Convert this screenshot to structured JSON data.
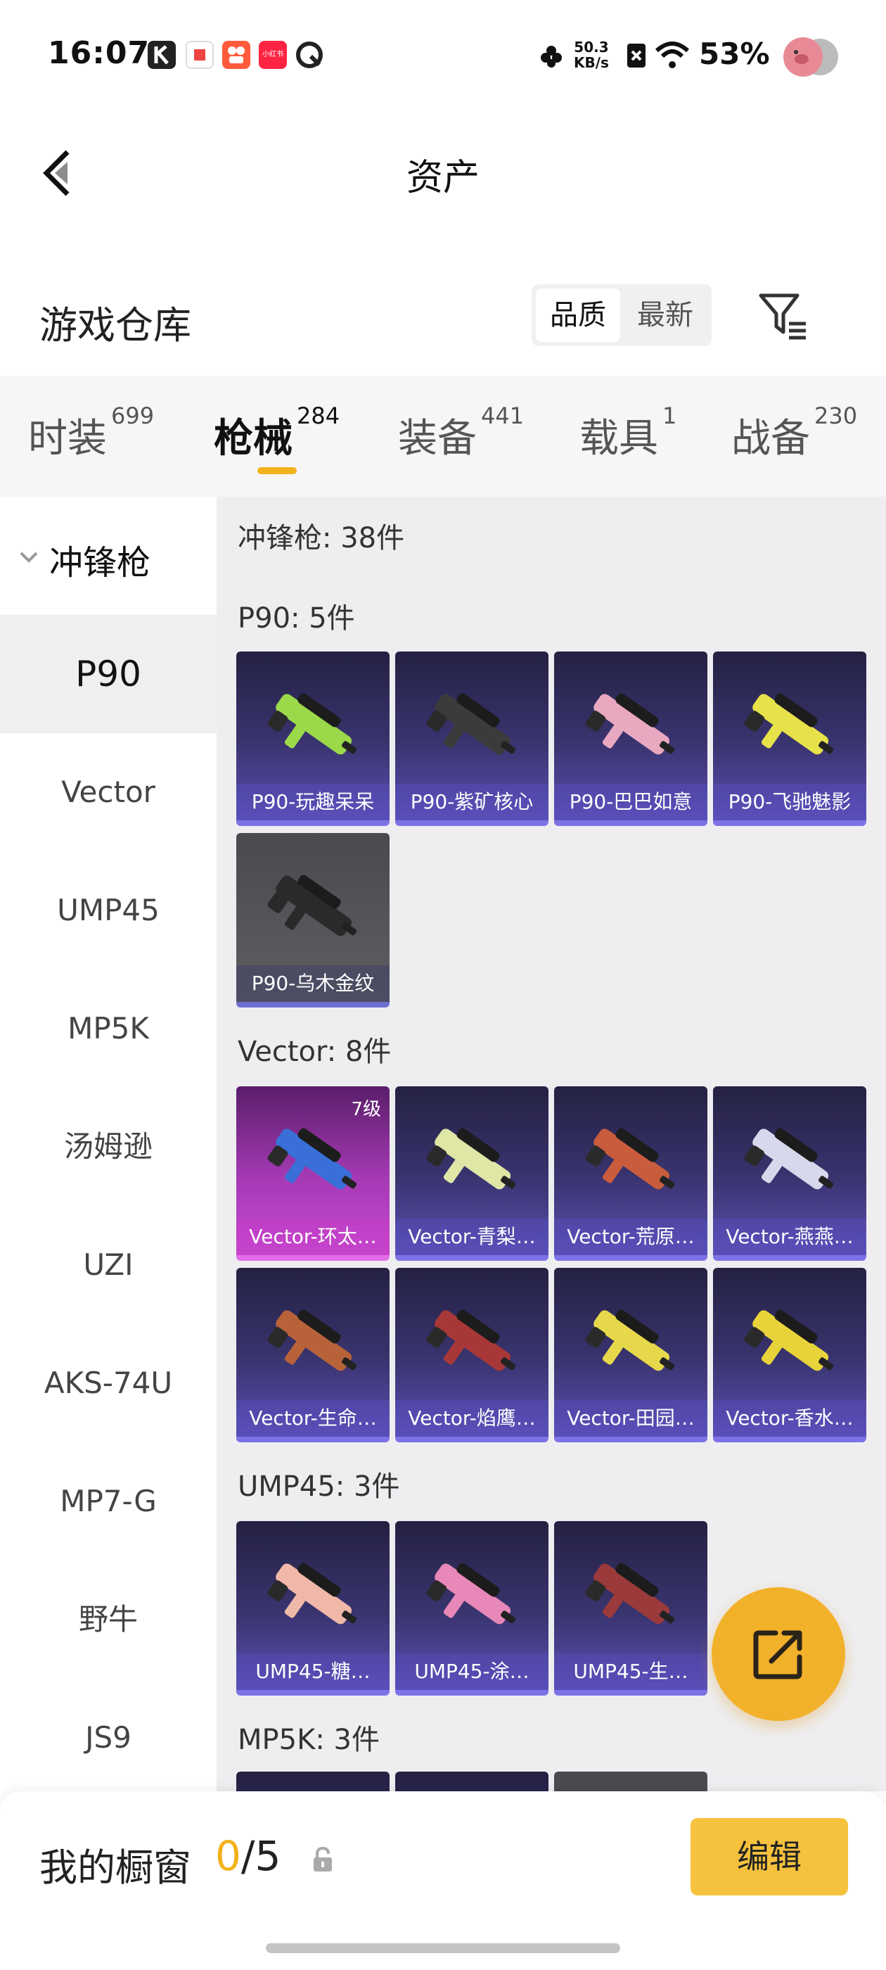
{
  "status_bar": {
    "time": "16:07",
    "net_speed_value": "50.3",
    "net_speed_unit": "KB/s",
    "battery": "53%",
    "icons": [
      "k-app-icon",
      "notification-icon",
      "kuaishou-icon",
      "xiaohongshu-icon",
      "browser-icon",
      "flower-icon",
      "sim-off-icon",
      "wifi-icon",
      "pig-avatar-icon"
    ],
    "mini_icon_text": "小红书"
  },
  "header": {
    "title": "资产",
    "back_icon": "back-chevron-icon"
  },
  "warehouse": {
    "title": "游戏仓库",
    "sort_options": [
      "品质",
      "最新"
    ],
    "sort_selected": "品质",
    "filter_icon": "filter-icon"
  },
  "category_tabs": [
    {
      "label": "时装",
      "count": "699"
    },
    {
      "label": "枪械",
      "count": "284",
      "active": true
    },
    {
      "label": "装备",
      "count": "441"
    },
    {
      "label": "载具",
      "count": "1"
    },
    {
      "label": "战备",
      "count": "230"
    }
  ],
  "sidebar": {
    "group_label": "冲锋枪",
    "items": [
      "P90",
      "Vector",
      "UMP45",
      "MP5K",
      "汤姆逊",
      "UZI",
      "AKS-74U",
      "MP7-G",
      "野牛",
      "JS9"
    ],
    "active": "P90"
  },
  "content": {
    "total_label": "冲锋枪: 38件",
    "sections": [
      {
        "title": "P90: 5件",
        "items": [
          {
            "name": "P90-玩趣呆呆",
            "style": "purple",
            "gun_color": "#9bd94a"
          },
          {
            "name": "P90-紫矿核心",
            "style": "purple",
            "gun_color": "#3b3b3b"
          },
          {
            "name": "P90-巴巴如意",
            "style": "purple",
            "gun_color": "#e8a9c0"
          },
          {
            "name": "P90-飞驰魅影",
            "style": "purple",
            "gun_color": "#e8e24a"
          },
          {
            "name": "P90-乌木金纹",
            "style": "gray",
            "gun_color": "#2a2a2a"
          }
        ]
      },
      {
        "title": "Vector: 8件",
        "items": [
          {
            "name": "Vector-环太…",
            "style": "pink",
            "level": "7级",
            "gun_color": "#3a6fd8"
          },
          {
            "name": "Vector-青梨…",
            "style": "purple",
            "gun_color": "#dfe6a6"
          },
          {
            "name": "Vector-荒原…",
            "style": "purple",
            "gun_color": "#c85c3c"
          },
          {
            "name": "Vector-燕燕…",
            "style": "purple",
            "gun_color": "#d8d8ec"
          },
          {
            "name": "Vector-生命…",
            "style": "purple",
            "gun_color": "#b8623a"
          },
          {
            "name": "Vector-焰鹰…",
            "style": "purple",
            "gun_color": "#a83838"
          },
          {
            "name": "Vector-田园…",
            "style": "purple",
            "gun_color": "#e6d84a"
          },
          {
            "name": "Vector-香水…",
            "style": "purple",
            "gun_color": "#e8d43a"
          }
        ]
      },
      {
        "title": "UMP45: 3件",
        "items": [
          {
            "name": "UMP45-糖…",
            "style": "purple",
            "gun_color": "#f0b8a8"
          },
          {
            "name": "UMP45-涂…",
            "style": "purple",
            "gun_color": "#e888b8"
          },
          {
            "name": "UMP45-生…",
            "style": "purple",
            "gun_color": "#9a3a3a"
          }
        ]
      },
      {
        "title": "MP5K: 3件",
        "items": []
      }
    ]
  },
  "fab": {
    "icon": "share-external-icon"
  },
  "bottom_bar": {
    "label": "我的橱窗",
    "count_current": "0",
    "count_sep_total": "/5",
    "lock_icon": "lock-icon",
    "edit_label": "编辑"
  },
  "colors": {
    "accent": "#f2b21c",
    "edit_button": "#f6c23e",
    "count_current": "#f2b21c"
  }
}
